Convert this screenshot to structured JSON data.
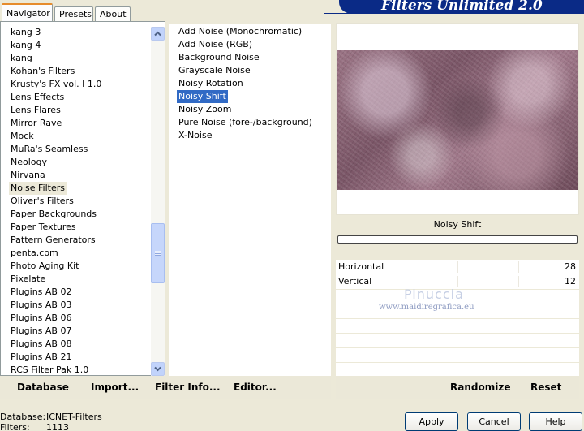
{
  "app": {
    "title": "Filters Unlimited 2.0"
  },
  "tabs": [
    {
      "label": "Navigator",
      "active": true
    },
    {
      "label": "Presets",
      "active": false
    },
    {
      "label": "About",
      "active": false
    }
  ],
  "navigator": {
    "items": [
      "kang 3",
      "kang 4",
      "kang",
      "Kohan's Filters",
      "Krusty's FX vol. I 1.0",
      "Lens Effects",
      "Lens Flares",
      "Mirror Rave",
      "Mock",
      "MuRa's Seamless",
      "Neology",
      "Nirvana",
      "Noise Filters",
      "Oliver's Filters",
      "Paper Backgrounds",
      "Paper Textures",
      "Pattern Generators",
      "penta.com",
      "Photo Aging Kit",
      "Pixelate",
      "Plugins AB 02",
      "Plugins AB 03",
      "Plugins AB 06",
      "Plugins AB 07",
      "Plugins AB 08",
      "Plugins AB 21",
      "RCS Filter Pak 1.0"
    ],
    "selected": "Noise Filters"
  },
  "filters": {
    "items": [
      "Add Noise (Monochromatic)",
      "Add Noise (RGB)",
      "Background Noise",
      "Grayscale Noise",
      "Noisy Rotation",
      "Noisy Shift",
      "Noisy Zoom",
      "Pure Noise (fore-/background)",
      "X-Noise"
    ],
    "selected": "Noisy Shift"
  },
  "preview": {
    "filter_name": "Noisy Shift"
  },
  "watermark": {
    "line1": "Pinuccia",
    "line2": "www.maidiregrafica.eu"
  },
  "parameters": [
    {
      "label": "Horizontal",
      "value": "28"
    },
    {
      "label": "Vertical",
      "value": "12"
    }
  ],
  "left_buttons": {
    "database": "Database",
    "import": "Import...",
    "filter_info": "Filter Info...",
    "editor": "Editor..."
  },
  "right_buttons": {
    "randomize": "Randomize",
    "reset": "Reset"
  },
  "status": {
    "database_label": "Database:",
    "database_value": "ICNET-Filters",
    "filters_label": "Filters:",
    "filters_value": "1113"
  },
  "dialog_buttons": {
    "apply": "Apply",
    "cancel": "Cancel",
    "help": "Help"
  },
  "colors": {
    "banner": "#0a2a86",
    "selection": "#316ac5",
    "tab_accent": "#e68b2c",
    "window_bg": "#ece9d8"
  },
  "icons": {
    "scroll_up": "chevron-up-icon",
    "scroll_down": "chevron-down-icon",
    "thumb_grip": "grip-icon"
  }
}
